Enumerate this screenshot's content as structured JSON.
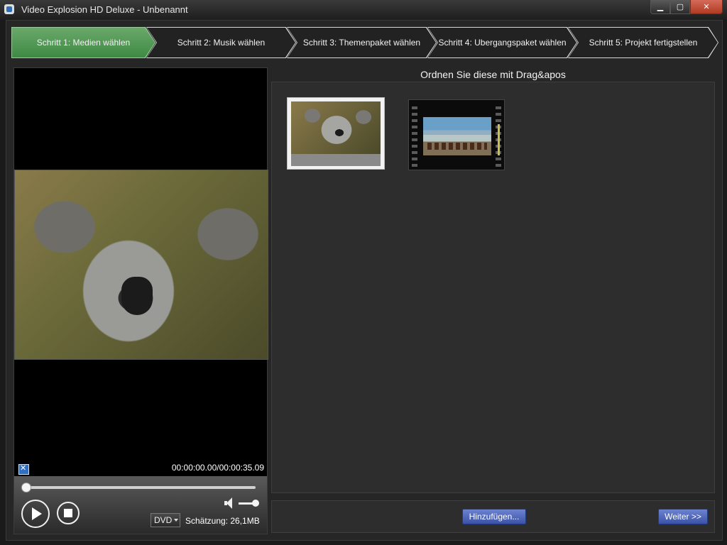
{
  "window": {
    "title": "Video Explosion HD Deluxe - Unbenannt",
    "controls": {
      "minimize": "▁",
      "maximize": "▢",
      "close": "✕"
    }
  },
  "steps": [
    {
      "label": "Schritt 1: Medien wählen",
      "active": true
    },
    {
      "label": "Schritt 2: Musik wählen",
      "active": false
    },
    {
      "label": "Schritt 3: Themenpaket wählen",
      "active": false
    },
    {
      "label": "Schritt 4: Ubergangspaket wählen",
      "active": false
    },
    {
      "label": "Schritt 5: Projekt fertigstellen",
      "active": false
    }
  ],
  "preview": {
    "time": "00:00:00.00/00:00:35.09",
    "seek_position": 0.0,
    "volume_level": 1.0,
    "format": "DVD",
    "estimate": "Schätzung: 26,1MB"
  },
  "media": {
    "heading": "Ordnen Sie diese mit Drag&apos",
    "items": [
      {
        "type": "photo",
        "icon": "koala-photo-thumbnail"
      },
      {
        "type": "video",
        "icon": "film-clip-thumbnail"
      }
    ]
  },
  "buttons": {
    "add": "Hinzufügen...",
    "next": "Weiter >>"
  },
  "colors": {
    "active_step": "#4e9a54",
    "button_blue": "#4c62b8"
  }
}
